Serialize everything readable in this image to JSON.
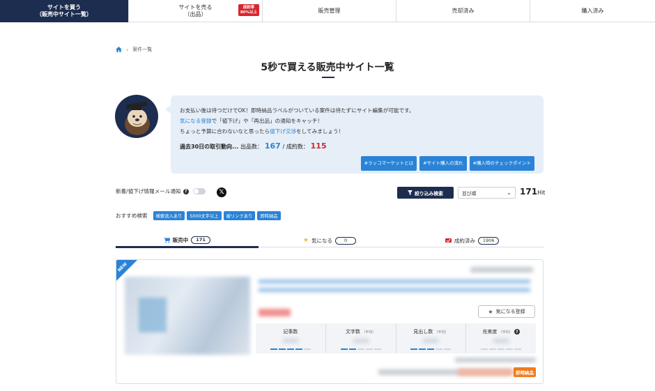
{
  "nav": {
    "buy": "サイトを買う\n（販売中サイト一覧）",
    "sell": "サイトを売る\n（出品）",
    "sell_badge": "成約率\n80%以上",
    "manage": "販売管理",
    "sold": "売却済み",
    "bought": "購入済み"
  },
  "breadcrumb": {
    "current": "案件一覧"
  },
  "page_title": "5秒で買える販売中サイト一覧",
  "message": {
    "line1": "お支払い後は待つだけでOK！即時納品ラベルがついている案件は待たずにサイト編集が可能です。",
    "line2_link": "気になる登録",
    "line2_rest": "で「値下げ」や「再出品」の通知をキャッチ！",
    "line3_pre": "ちょっと予算に合わないなと思ったら",
    "line3_link": "値下げ交渉",
    "line3_post": "をしてみましょう！",
    "stats_label": "過去30日の取引動向...",
    "listed_label": "出品数：",
    "listed_value": "167",
    "closed_label": "成約数：",
    "closed_value": "115",
    "tags": [
      "#ラッコマーケットとは",
      "#サイト購入の流れ",
      "#購入時のチェックポイント"
    ]
  },
  "notify": {
    "label": "新着/値下げ情報メール通知",
    "help": "?",
    "x": "𝕏"
  },
  "filter_button": "絞り込み検索",
  "sort": {
    "selected": "並び順"
  },
  "hits": {
    "count": "171",
    "unit": "Hit"
  },
  "recommended": {
    "label": "おすすめ検索",
    "tags": [
      "検索流入あり",
      "5000文字以上",
      "被リンクあり",
      "即時納品"
    ]
  },
  "tabs": [
    {
      "label": "販売中",
      "count": "171"
    },
    {
      "label": "気になる",
      "count": "0"
    },
    {
      "label": "成約済み",
      "count": "1906"
    }
  ],
  "card": {
    "new_label": "NEW",
    "fav_button": "気になる登録",
    "metrics": [
      {
        "label": "記事数",
        "sub": ""
      },
      {
        "label": "文字数",
        "sub": "（平均）"
      },
      {
        "label": "見出し数",
        "sub": "（平均）"
      },
      {
        "label": "充実度",
        "sub": "（平均）"
      }
    ],
    "metric_levels": [
      4,
      2,
      3,
      0
    ],
    "instant_badge": "即時納品"
  },
  "colors": {
    "navy": "#1c2d4f",
    "blue": "#2a83d6",
    "red": "#d7262d",
    "orange": "#f07b1e"
  }
}
